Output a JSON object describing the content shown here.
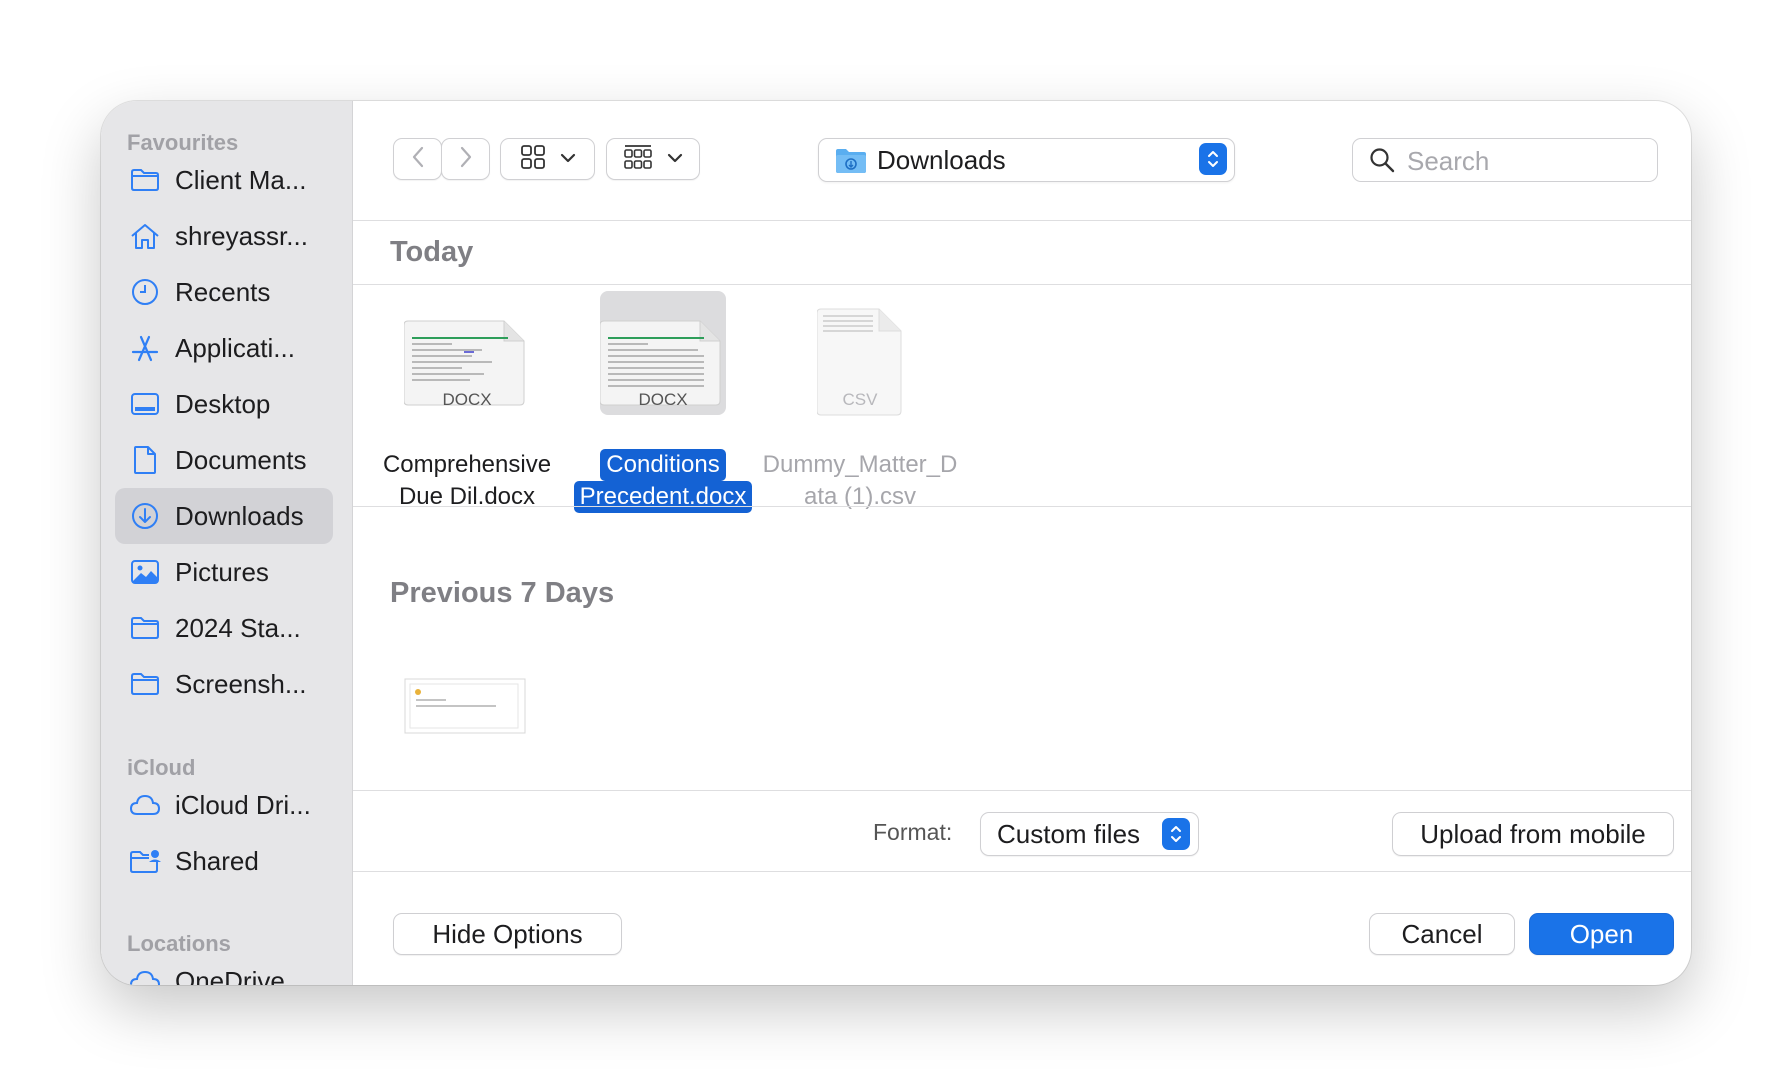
{
  "sidebar": {
    "favourites_header": "Favourites",
    "icloud_header": "iCloud",
    "locations_header": "Locations",
    "favourites": [
      {
        "label": "Client Ma...",
        "icon": "folder-icon"
      },
      {
        "label": "shreyassr...",
        "icon": "home-icon"
      },
      {
        "label": "Recents",
        "icon": "clock-icon"
      },
      {
        "label": "Applicati...",
        "icon": "applications-icon"
      },
      {
        "label": "Desktop",
        "icon": "desktop-icon"
      },
      {
        "label": "Documents",
        "icon": "document-icon"
      },
      {
        "label": "Downloads",
        "icon": "download-icon",
        "selected": true
      },
      {
        "label": "Pictures",
        "icon": "photo-icon"
      },
      {
        "label": "2024 Sta...",
        "icon": "folder-icon"
      },
      {
        "label": "Screensh...",
        "icon": "folder-icon"
      }
    ],
    "icloud": [
      {
        "label": "iCloud Dri...",
        "icon": "cloud-icon"
      },
      {
        "label": "Shared",
        "icon": "shared-folder-icon"
      }
    ],
    "locations": [
      {
        "label": "OneDrive",
        "icon": "cloud-icon"
      }
    ]
  },
  "toolbar": {
    "location": "Downloads",
    "search_placeholder": "Search"
  },
  "sections": {
    "today": "Today",
    "previous": "Previous 7 Days"
  },
  "files_today": [
    {
      "line1": "Comprehensive",
      "line2": "Due Dil.docx",
      "badge": "DOCX",
      "selected": false,
      "enabled": true
    },
    {
      "line1": "Conditions",
      "line2": "Precedent.docx",
      "badge": "DOCX",
      "selected": true,
      "enabled": true
    },
    {
      "line1": "Dummy_Matter_D",
      "line2": "ata (1).csv",
      "badge": "CSV",
      "selected": false,
      "enabled": false
    }
  ],
  "options": {
    "format_label": "Format:",
    "format_value": "Custom files",
    "upload_label": "Upload from mobile"
  },
  "footer": {
    "hide_options": "Hide Options",
    "cancel": "Cancel",
    "open": "Open"
  },
  "colors": {
    "accent": "#1a73e8",
    "selection": "#1462d4",
    "sidebar_icon": "#2f7ff5"
  }
}
